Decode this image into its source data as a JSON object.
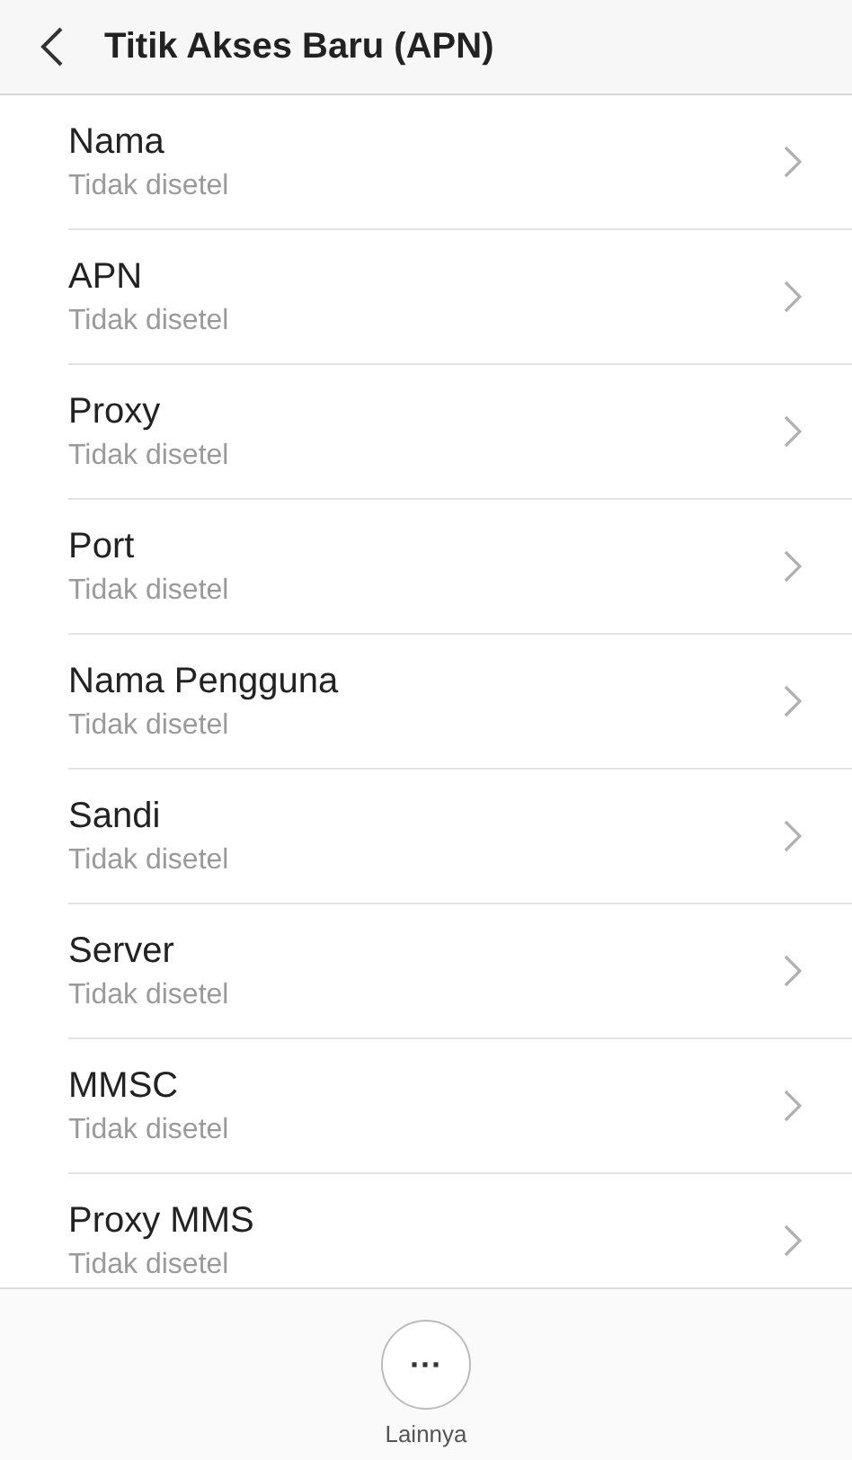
{
  "header": {
    "title": "Titik Akses Baru (APN)"
  },
  "items": [
    {
      "label": "Nama",
      "value": "Tidak disetel"
    },
    {
      "label": "APN",
      "value": "Tidak disetel"
    },
    {
      "label": "Proxy",
      "value": "Tidak disetel"
    },
    {
      "label": "Port",
      "value": "Tidak disetel"
    },
    {
      "label": "Nama Pengguna",
      "value": "Tidak disetel"
    },
    {
      "label": "Sandi",
      "value": "Tidak disetel"
    },
    {
      "label": "Server",
      "value": "Tidak disetel"
    },
    {
      "label": "MMSC",
      "value": "Tidak disetel"
    },
    {
      "label": "Proxy MMS",
      "value": "Tidak disetel"
    }
  ],
  "bottom": {
    "more_symbol": "···",
    "more_label": "Lainnya"
  }
}
